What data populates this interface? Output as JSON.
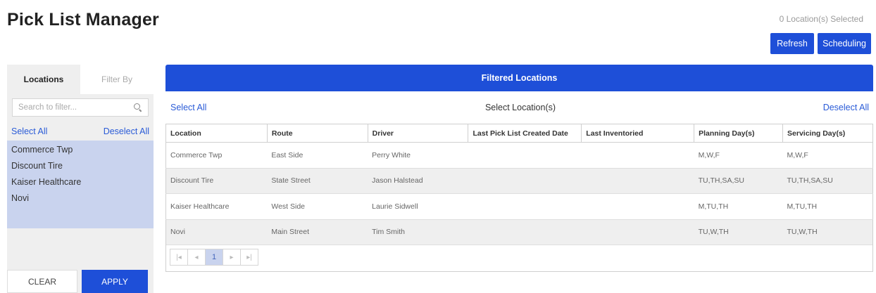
{
  "page": {
    "title": "Pick List Manager",
    "selected_count": "0 Location(s) Selected"
  },
  "actions": {
    "refresh": "Refresh",
    "scheduling": "Scheduling"
  },
  "sidebar": {
    "tabs": [
      "Locations",
      "Filter By"
    ],
    "search_placeholder": "Search to filter...",
    "select_all": "Select All",
    "deselect_all": "Deselect All",
    "items": [
      "Commerce Twp",
      "Discount Tire",
      "Kaiser Healthcare",
      "Novi"
    ],
    "clear": "CLEAR",
    "apply": "APPLY"
  },
  "panel": {
    "title": "Filtered Locations",
    "select_all": "Select All",
    "center_label": "Select Location(s)",
    "deselect_all": "Deselect All",
    "columns": [
      "Location",
      "Route",
      "Driver",
      "Last Pick List Created Date",
      "Last Inventoried",
      "Planning Day(s)",
      "Servicing Day(s)"
    ],
    "rows": [
      [
        "Commerce Twp",
        "East Side",
        "Perry White",
        "",
        "",
        "M,W,F",
        "M,W,F"
      ],
      [
        "Discount Tire",
        "State Street",
        "Jason Halstead",
        "",
        "",
        "TU,TH,SA,SU",
        "TU,TH,SA,SU"
      ],
      [
        "Kaiser Healthcare",
        "West Side",
        "Laurie Sidwell",
        "",
        "",
        "M,TU,TH",
        "M,TU,TH"
      ],
      [
        "Novi",
        "Main Street",
        "Tim Smith",
        "",
        "",
        "TU,W,TH",
        "TU,W,TH"
      ]
    ]
  },
  "pager": {
    "first": "|◂",
    "prev": "◂",
    "current_page": "1",
    "next": "▸",
    "last": "▸|"
  },
  "colors": {
    "accent": "#1e4fd8",
    "selection": "#c9d3ee",
    "link": "#2a5bd7"
  }
}
